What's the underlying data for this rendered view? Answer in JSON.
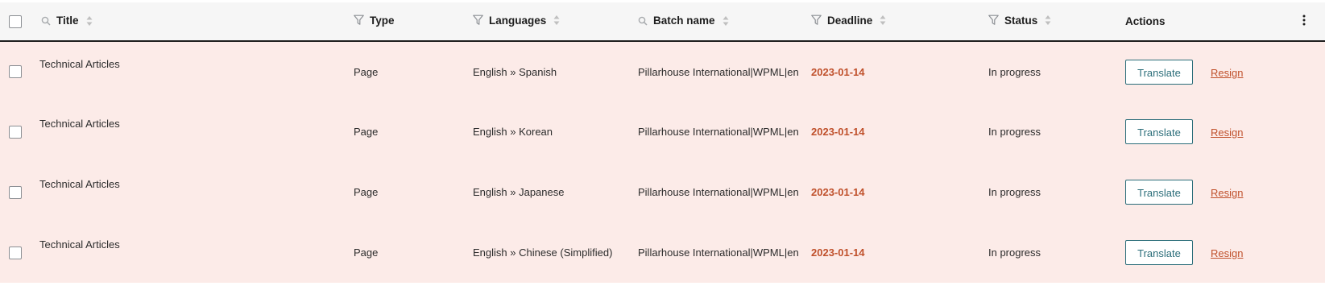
{
  "columns": {
    "title": "Title",
    "type": "Type",
    "languages": "Languages",
    "batch_name": "Batch name",
    "deadline": "Deadline",
    "status": "Status",
    "actions": "Actions"
  },
  "icons": {
    "title_col": "search-icon",
    "type_col": "filter-icon",
    "languages_col": "filter-icon",
    "batch_col": "search-icon",
    "deadline_col": "filter-icon",
    "status_col": "filter-icon",
    "sort": "sort-arrows-icon",
    "more": "more-vertical-icon"
  },
  "colors": {
    "row_background": "#fcebe8",
    "header_background": "#f6f6f6",
    "deadline": "#c0512c",
    "translate_button": "#2c6e7a",
    "resign_link": "#c0512c"
  },
  "rows": [
    {
      "title": "Technical Articles",
      "type": "Page",
      "languages": "English » Spanish",
      "batch_name": "Pillarhouse International|WPML|en",
      "deadline": "2023-01-14",
      "status": "In progress",
      "translate_label": "Translate",
      "resign_label": "Resign"
    },
    {
      "title": "Technical Articles",
      "type": "Page",
      "languages": "English » Korean",
      "batch_name": "Pillarhouse International|WPML|en",
      "deadline": "2023-01-14",
      "status": "In progress",
      "translate_label": "Translate",
      "resign_label": "Resign"
    },
    {
      "title": "Technical Articles",
      "type": "Page",
      "languages": "English » Japanese",
      "batch_name": "Pillarhouse International|WPML|en",
      "deadline": "2023-01-14",
      "status": "In progress",
      "translate_label": "Translate",
      "resign_label": "Resign"
    },
    {
      "title": "Technical Articles",
      "type": "Page",
      "languages": "English » Chinese (Simplified)",
      "batch_name": "Pillarhouse International|WPML|en",
      "deadline": "2023-01-14",
      "status": "In progress",
      "translate_label": "Translate",
      "resign_label": "Resign"
    }
  ]
}
